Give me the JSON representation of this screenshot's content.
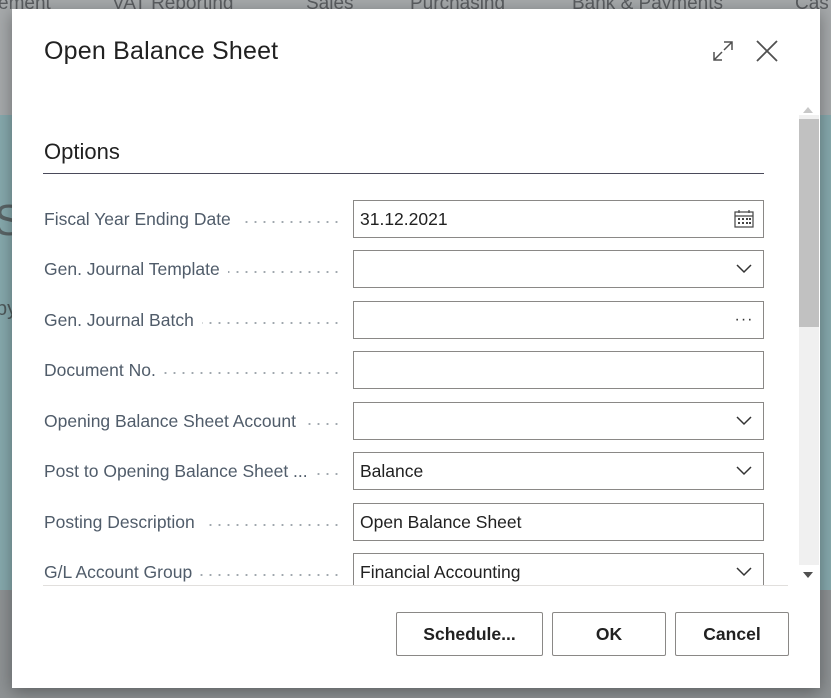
{
  "background": {
    "nav_items": [
      "ement",
      "VAT Reporting",
      "Sales",
      "Purchasing",
      "Bank & Payments",
      "Cas"
    ],
    "big_letter": "S",
    "side_text": "by"
  },
  "dialog": {
    "title": "Open Balance Sheet",
    "expand_icon": "expand-icon",
    "close_icon": "close-icon",
    "section_title": "Options",
    "fields": [
      {
        "label": "Fiscal Year Ending Date",
        "value": "31.12.2021",
        "icon": "calendar-icon"
      },
      {
        "label": "Gen. Journal Template",
        "value": "",
        "icon": "chevron-down-icon"
      },
      {
        "label": "Gen. Journal Batch",
        "value": "",
        "icon": "ellipsis-icon",
        "icon_text": "···"
      },
      {
        "label": "Document No.",
        "value": "",
        "icon": ""
      },
      {
        "label": "Opening Balance Sheet Account",
        "value": "",
        "icon": "chevron-down-icon"
      },
      {
        "label": "Post to Opening Balance Sheet ...",
        "value": "Balance",
        "icon": "chevron-down-icon"
      },
      {
        "label": "Posting Description",
        "value": "Open Balance Sheet",
        "icon": ""
      },
      {
        "label": "G/L Account Group",
        "value": "Financial Accounting",
        "icon": "chevron-down-icon"
      }
    ],
    "buttons": {
      "schedule": "Schedule...",
      "ok": "OK",
      "cancel": "Cancel"
    }
  },
  "colors": {
    "label": "#505c6a",
    "border": "#8a8886",
    "text": "#212121"
  }
}
